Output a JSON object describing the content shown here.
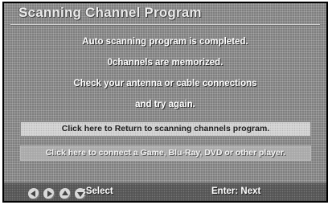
{
  "screen": {
    "title": "Scanning Channel Program",
    "messages": [
      "Auto scanning program is completed.",
      "0channels are memorized.",
      "Check your antenna or cable connections",
      "and try again."
    ],
    "buttons": {
      "return_label": "Click here to Return to scanning channels program.",
      "connect_label": "Click here to connect a Game, Blu-Ray, DVD or other player."
    },
    "footer": {
      "arrow_icons": [
        "left-arrow-icon",
        "right-arrow-icon",
        "up-arrow-icon",
        "down-arrow-icon"
      ],
      "select_label": ":Select",
      "enter_label": "Enter: Next"
    },
    "colors": {
      "panel": "#8c8c8c",
      "highlight_button": "#d6d6d6",
      "footer": "#555555"
    }
  }
}
